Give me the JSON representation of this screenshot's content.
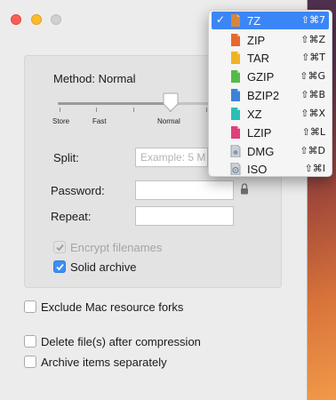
{
  "window": {
    "method_label": "Method: Normal",
    "compression_levels": [
      "Store",
      "Fast",
      "Normal"
    ],
    "split_label": "Split:",
    "split_placeholder": "Example: 5 M",
    "password_label": "Password:",
    "password_value": "",
    "repeat_label": "Repeat:",
    "repeat_value": "",
    "encrypt_filenames": {
      "label": "Encrypt filenames",
      "checked": true,
      "enabled": false
    },
    "solid_archive": {
      "label": "Solid archive",
      "checked": true
    },
    "exclude_forks": {
      "label": "Exclude Mac resource forks",
      "checked": false
    },
    "delete_after": {
      "label": "Delete file(s) after compression",
      "checked": false
    },
    "archive_separately": {
      "label": "Archive items separately",
      "checked": false
    }
  },
  "format_menu": {
    "selected": "7Z",
    "items": [
      {
        "name": "7Z",
        "shortcut": "⇧⌘7",
        "color": "#d9853b",
        "icon": "7z-file-icon"
      },
      {
        "name": "ZIP",
        "shortcut": "⇧⌘Z",
        "color": "#e8692e",
        "icon": "zip-file-icon"
      },
      {
        "name": "TAR",
        "shortcut": "⇧⌘T",
        "color": "#f0b323",
        "icon": "tar-file-icon"
      },
      {
        "name": "GZIP",
        "shortcut": "⇧⌘G",
        "color": "#57b94a",
        "icon": "gzip-file-icon"
      },
      {
        "name": "BZIP2",
        "shortcut": "⇧⌘B",
        "color": "#3b82d8",
        "icon": "bzip2-file-icon"
      },
      {
        "name": "XZ",
        "shortcut": "⇧⌘X",
        "color": "#29bfb5",
        "icon": "xz-file-icon"
      },
      {
        "name": "LZIP",
        "shortcut": "⇧⌘L",
        "color": "#e0407a",
        "icon": "lzip-file-icon"
      },
      {
        "name": "DMG",
        "shortcut": "⇧⌘D",
        "color": "#9aa3ad",
        "icon": "dmg-disk-icon"
      },
      {
        "name": "ISO",
        "shortcut": "⇧⌘I",
        "color": "#9aa3ad",
        "icon": "iso-disc-icon"
      }
    ]
  }
}
